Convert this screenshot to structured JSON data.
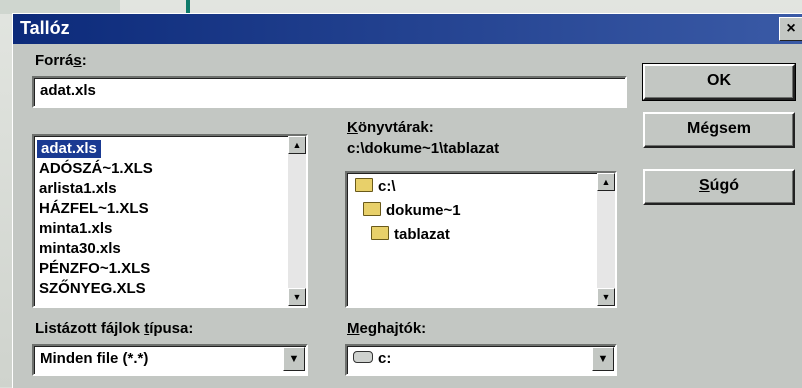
{
  "dialog": {
    "title": "Tallóz",
    "close_glyph": "×"
  },
  "source": {
    "label_pre": "Forrá",
    "label_hot": "s",
    "label_post": ":",
    "value": "adat.xls"
  },
  "files": {
    "items": [
      "adat.xls",
      "ADÓSZÁ~1.XLS",
      "arlista1.xls",
      "HÁZFEL~1.XLS",
      "minta1.xls",
      "minta30.xls",
      "PÉNZFO~1.XLS",
      "SZŐNYEG.XLS"
    ],
    "selected_index": 0
  },
  "folders": {
    "label_hot": "K",
    "label_rest": "önyvtárak:",
    "current_path": "c:\\dokume~1\\tablazat",
    "items": [
      "c:\\",
      "dokume~1",
      "tablazat"
    ]
  },
  "file_type": {
    "label_pre": "Listázott fájlok ",
    "label_hot": "t",
    "label_post": "ípusa:",
    "value": "Minden file (*.*)"
  },
  "drives": {
    "label_hot": "M",
    "label_rest": "eghajtók:",
    "value": "c:"
  },
  "buttons": {
    "ok": "OK",
    "cancel": "Mégsem",
    "help_pre": "",
    "help_hot": "S",
    "help_post": "úgó"
  },
  "icons": {
    "up_arrow": "▲",
    "down_arrow": "▼",
    "folder": "folder-icon",
    "drive": "drive-icon"
  }
}
